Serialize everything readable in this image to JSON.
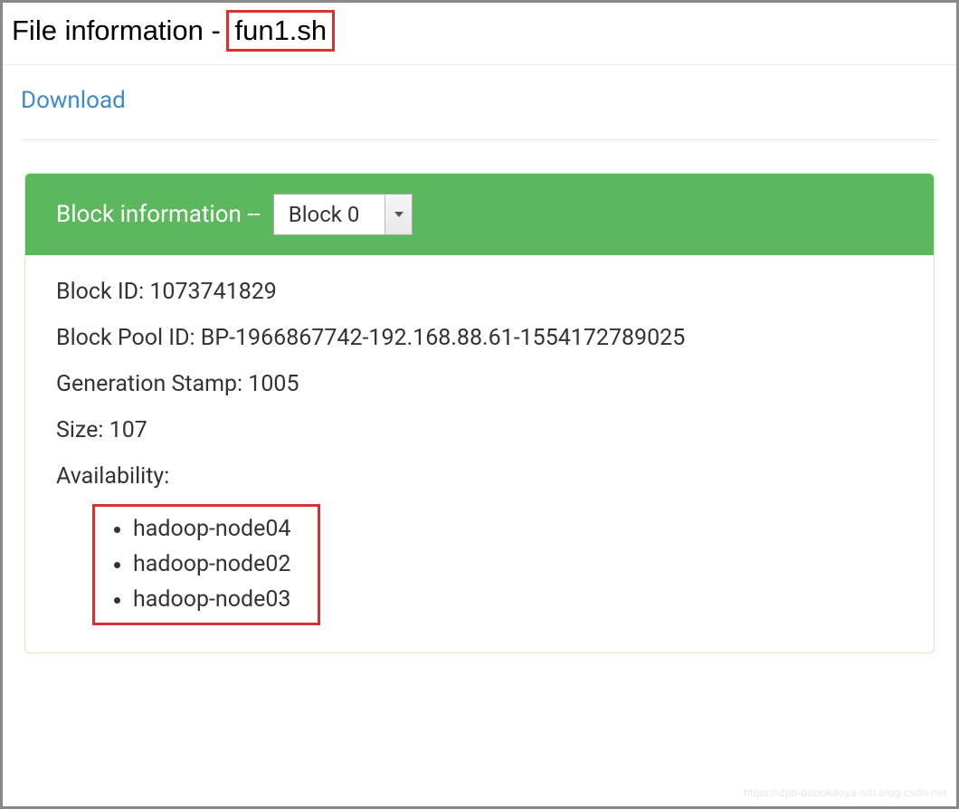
{
  "header": {
    "title_prefix": "File information - ",
    "filename": "fun1.sh"
  },
  "actions": {
    "download_label": "Download"
  },
  "block_panel": {
    "header_label": "Block information --",
    "selected_block": "Block 0",
    "fields": {
      "block_id": {
        "label": "Block ID:",
        "value": "1073741829"
      },
      "block_pool_id": {
        "label": "Block Pool ID:",
        "value": "BP-1966867742-192.168.88.61-1554172789025"
      },
      "generation_stamp": {
        "label": "Generation Stamp:",
        "value": "1005"
      },
      "size": {
        "label": "Size:",
        "value": "107"
      },
      "availability_label": "Availability:"
    },
    "availability": [
      "hadoop-node04",
      "hadoop-node02",
      "hadoop-node03"
    ]
  },
  "watermark": "https://dpb-bobokaoya-sm.blog.csdn.net"
}
